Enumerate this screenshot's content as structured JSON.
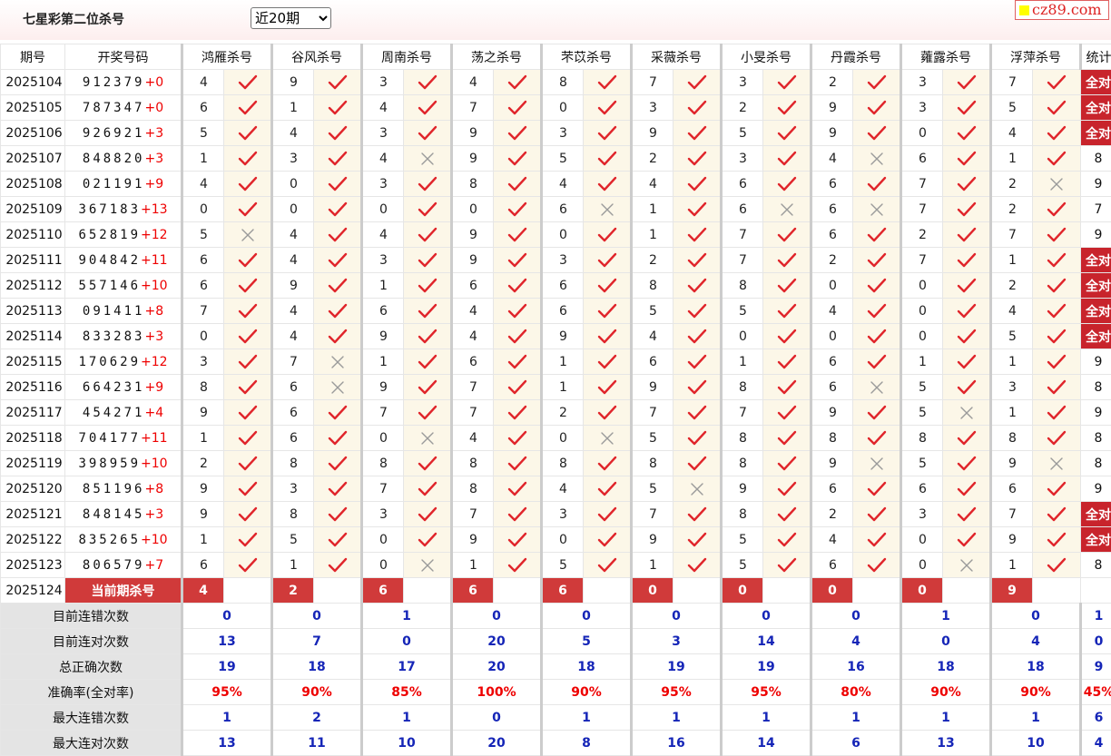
{
  "page": {
    "title": "七星彩第二位杀号",
    "period_select": {
      "value": "近20期",
      "options": [
        "近20期"
      ]
    },
    "logo_text": "cz89.com"
  },
  "headers": {
    "period": "期号",
    "number": "开奖号码",
    "stats": "统计"
  },
  "killers": [
    "鸿雁杀号",
    "谷风杀号",
    "周南杀号",
    "荡之杀号",
    "芣苡杀号",
    "采薇杀号",
    "小旻杀号",
    "丹霞杀号",
    "蕹露杀号",
    "浮萍杀号"
  ],
  "rows": [
    {
      "period": "2025104",
      "digits": "912379",
      "extra": "+0",
      "vals": [
        "4",
        "9",
        "3",
        "4",
        "8",
        "7",
        "3",
        "2",
        "3",
        "7"
      ],
      "ok": [
        1,
        1,
        1,
        1,
        1,
        1,
        1,
        1,
        1,
        1
      ],
      "stat": "全对"
    },
    {
      "period": "2025105",
      "digits": "787347",
      "extra": "+0",
      "vals": [
        "6",
        "1",
        "4",
        "7",
        "0",
        "3",
        "2",
        "9",
        "3",
        "5"
      ],
      "ok": [
        1,
        1,
        1,
        1,
        1,
        1,
        1,
        1,
        1,
        1
      ],
      "stat": "全对"
    },
    {
      "period": "2025106",
      "digits": "926921",
      "extra": "+3",
      "vals": [
        "5",
        "4",
        "3",
        "9",
        "3",
        "9",
        "5",
        "9",
        "0",
        "4"
      ],
      "ok": [
        1,
        1,
        1,
        1,
        1,
        1,
        1,
        1,
        1,
        1
      ],
      "stat": "全对"
    },
    {
      "period": "2025107",
      "digits": "848820",
      "extra": "+3",
      "vals": [
        "1",
        "3",
        "4",
        "9",
        "5",
        "2",
        "3",
        "4",
        "6",
        "1"
      ],
      "ok": [
        1,
        1,
        0,
        1,
        1,
        1,
        1,
        0,
        1,
        1
      ],
      "stat": "8"
    },
    {
      "period": "2025108",
      "digits": "021191",
      "extra": "+9",
      "vals": [
        "4",
        "0",
        "3",
        "8",
        "4",
        "4",
        "6",
        "6",
        "7",
        "2"
      ],
      "ok": [
        1,
        1,
        1,
        1,
        1,
        1,
        1,
        1,
        1,
        0
      ],
      "stat": "9"
    },
    {
      "period": "2025109",
      "digits": "367183",
      "extra": "+13",
      "vals": [
        "0",
        "0",
        "0",
        "0",
        "6",
        "1",
        "6",
        "6",
        "7",
        "2"
      ],
      "ok": [
        1,
        1,
        1,
        1,
        0,
        1,
        0,
        0,
        1,
        1
      ],
      "stat": "7"
    },
    {
      "period": "2025110",
      "digits": "652819",
      "extra": "+12",
      "vals": [
        "5",
        "4",
        "4",
        "9",
        "0",
        "1",
        "7",
        "6",
        "2",
        "7"
      ],
      "ok": [
        0,
        1,
        1,
        1,
        1,
        1,
        1,
        1,
        1,
        1
      ],
      "stat": "9"
    },
    {
      "period": "2025111",
      "digits": "904842",
      "extra": "+11",
      "vals": [
        "6",
        "4",
        "3",
        "9",
        "3",
        "2",
        "7",
        "2",
        "7",
        "1"
      ],
      "ok": [
        1,
        1,
        1,
        1,
        1,
        1,
        1,
        1,
        1,
        1
      ],
      "stat": "全对"
    },
    {
      "period": "2025112",
      "digits": "557146",
      "extra": "+10",
      "vals": [
        "6",
        "9",
        "1",
        "6",
        "6",
        "8",
        "8",
        "0",
        "0",
        "2"
      ],
      "ok": [
        1,
        1,
        1,
        1,
        1,
        1,
        1,
        1,
        1,
        1
      ],
      "stat": "全对"
    },
    {
      "period": "2025113",
      "digits": "091411",
      "extra": "+8",
      "vals": [
        "7",
        "4",
        "6",
        "4",
        "6",
        "5",
        "5",
        "4",
        "0",
        "4"
      ],
      "ok": [
        1,
        1,
        1,
        1,
        1,
        1,
        1,
        1,
        1,
        1
      ],
      "stat": "全对"
    },
    {
      "period": "2025114",
      "digits": "833283",
      "extra": "+3",
      "vals": [
        "0",
        "4",
        "9",
        "4",
        "9",
        "4",
        "0",
        "0",
        "0",
        "5"
      ],
      "ok": [
        1,
        1,
        1,
        1,
        1,
        1,
        1,
        1,
        1,
        1
      ],
      "stat": "全对"
    },
    {
      "period": "2025115",
      "digits": "170629",
      "extra": "+12",
      "vals": [
        "3",
        "7",
        "1",
        "6",
        "1",
        "6",
        "1",
        "6",
        "1",
        "1"
      ],
      "ok": [
        1,
        0,
        1,
        1,
        1,
        1,
        1,
        1,
        1,
        1
      ],
      "stat": "9"
    },
    {
      "period": "2025116",
      "digits": "664231",
      "extra": "+9",
      "vals": [
        "8",
        "6",
        "9",
        "7",
        "1",
        "9",
        "8",
        "6",
        "5",
        "3"
      ],
      "ok": [
        1,
        0,
        1,
        1,
        1,
        1,
        1,
        0,
        1,
        1
      ],
      "stat": "8"
    },
    {
      "period": "2025117",
      "digits": "454271",
      "extra": "+4",
      "vals": [
        "9",
        "6",
        "7",
        "7",
        "2",
        "7",
        "7",
        "9",
        "5",
        "1"
      ],
      "ok": [
        1,
        1,
        1,
        1,
        1,
        1,
        1,
        1,
        0,
        1
      ],
      "stat": "9"
    },
    {
      "period": "2025118",
      "digits": "704177",
      "extra": "+11",
      "vals": [
        "1",
        "6",
        "0",
        "4",
        "0",
        "5",
        "8",
        "8",
        "8",
        "8"
      ],
      "ok": [
        1,
        1,
        0,
        1,
        0,
        1,
        1,
        1,
        1,
        1
      ],
      "stat": "8"
    },
    {
      "period": "2025119",
      "digits": "398959",
      "extra": "+10",
      "vals": [
        "2",
        "8",
        "8",
        "8",
        "8",
        "8",
        "8",
        "9",
        "5",
        "9"
      ],
      "ok": [
        1,
        1,
        1,
        1,
        1,
        1,
        1,
        0,
        1,
        0
      ],
      "stat": "8"
    },
    {
      "period": "2025120",
      "digits": "851196",
      "extra": "+8",
      "vals": [
        "9",
        "3",
        "7",
        "8",
        "4",
        "5",
        "9",
        "6",
        "6",
        "6"
      ],
      "ok": [
        1,
        1,
        1,
        1,
        1,
        0,
        1,
        1,
        1,
        1
      ],
      "stat": "9"
    },
    {
      "period": "2025121",
      "digits": "848145",
      "extra": "+3",
      "vals": [
        "9",
        "8",
        "3",
        "7",
        "3",
        "7",
        "8",
        "2",
        "3",
        "7"
      ],
      "ok": [
        1,
        1,
        1,
        1,
        1,
        1,
        1,
        1,
        1,
        1
      ],
      "stat": "全对"
    },
    {
      "period": "2025122",
      "digits": "835265",
      "extra": "+10",
      "vals": [
        "1",
        "5",
        "0",
        "9",
        "0",
        "9",
        "5",
        "4",
        "0",
        "9"
      ],
      "ok": [
        1,
        1,
        1,
        1,
        1,
        1,
        1,
        1,
        1,
        1
      ],
      "stat": "全对"
    },
    {
      "period": "2025123",
      "digits": "806579",
      "extra": "+7",
      "vals": [
        "6",
        "1",
        "0",
        "1",
        "5",
        "1",
        "5",
        "6",
        "0",
        "1"
      ],
      "ok": [
        1,
        1,
        0,
        1,
        1,
        1,
        1,
        1,
        0,
        1
      ],
      "stat": "8"
    }
  ],
  "current": {
    "period": "2025124",
    "label": "当前期杀号",
    "vals": [
      "4",
      "2",
      "6",
      "6",
      "6",
      "0",
      "0",
      "0",
      "0",
      "9"
    ]
  },
  "stats": [
    {
      "label": "目前连错次数",
      "vals": [
        "0",
        "0",
        "1",
        "0",
        "0",
        "0",
        "0",
        "0",
        "1",
        "0"
      ],
      "last": "1"
    },
    {
      "label": "目前连对次数",
      "vals": [
        "13",
        "7",
        "0",
        "20",
        "5",
        "3",
        "14",
        "4",
        "0",
        "4"
      ],
      "last": "0"
    },
    {
      "label": "总正确次数",
      "vals": [
        "19",
        "18",
        "17",
        "20",
        "18",
        "19",
        "19",
        "16",
        "18",
        "18"
      ],
      "last": "9"
    },
    {
      "label": "准确率(全对率)",
      "vals": [
        "95%",
        "90%",
        "85%",
        "100%",
        "90%",
        "95%",
        "95%",
        "80%",
        "90%",
        "90%"
      ],
      "last": "45%",
      "rate": true
    },
    {
      "label": "最大连错次数",
      "vals": [
        "1",
        "2",
        "1",
        "0",
        "1",
        "1",
        "1",
        "1",
        "1",
        "1"
      ],
      "last": "6"
    },
    {
      "label": "最大连对次数",
      "vals": [
        "13",
        "11",
        "10",
        "20",
        "8",
        "16",
        "14",
        "6",
        "13",
        "10"
      ],
      "last": "4"
    }
  ],
  "icons": {
    "ok": "check-icon",
    "wrong": "cross-icon"
  },
  "colors": {
    "check": "#e0252b",
    "cross": "#9a9a9a",
    "badge": "#c8242c",
    "stat_value": "#1525b7",
    "rate": "#ee0000"
  }
}
